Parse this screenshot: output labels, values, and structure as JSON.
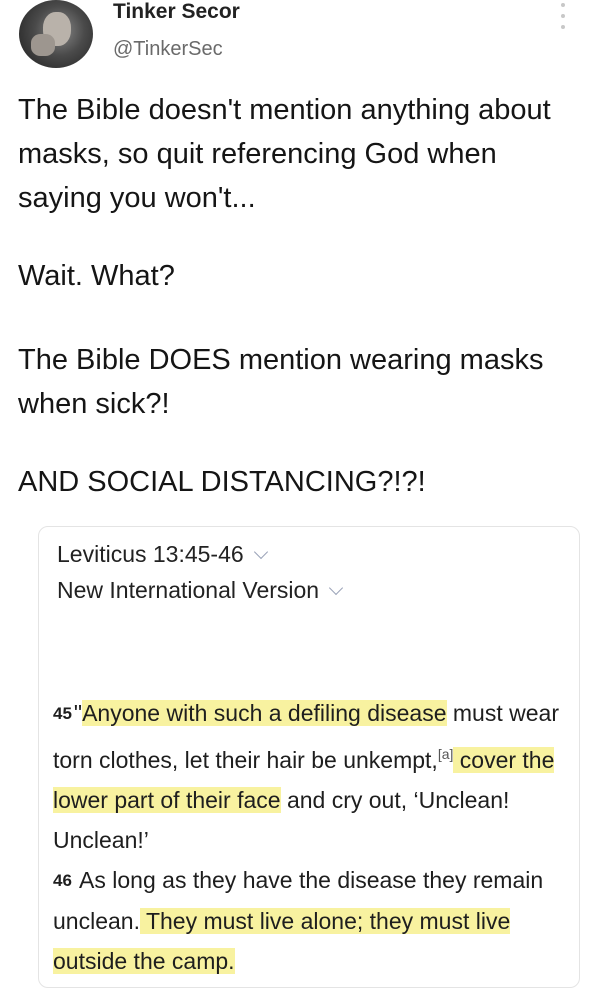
{
  "author": {
    "display_name": "Tinker Secor",
    "handle": "@TinkerSec"
  },
  "tweet": {
    "lines": [
      "The Bible doesn't mention anything about masks, so quit referencing God when saying you won't...",
      "Wait. What?",
      "The Bible DOES mention wearing masks when sick?!",
      "AND SOCIAL DISTANCING?!?!"
    ]
  },
  "bible_card": {
    "reference": "Leviticus 13:45-46",
    "version": "New International Version",
    "verse45": {
      "number": "45",
      "open_quote": "\"",
      "hl1": "Anyone with such a defiling disease",
      "text1": " must wear torn clothes, let their hair be unkempt,",
      "footnote": "[a]",
      "hl2": " cover the lower part of their face",
      "text2": " and cry out, ‘Unclean! Unclean!’"
    },
    "verse46": {
      "number": "46",
      "text1": " As long as they have the disease they remain unclean.",
      "hl1": " They must live alone; they must live outside the camp."
    }
  },
  "colors": {
    "highlight": "#f8f2a0",
    "handle": "#6a6a6a"
  }
}
